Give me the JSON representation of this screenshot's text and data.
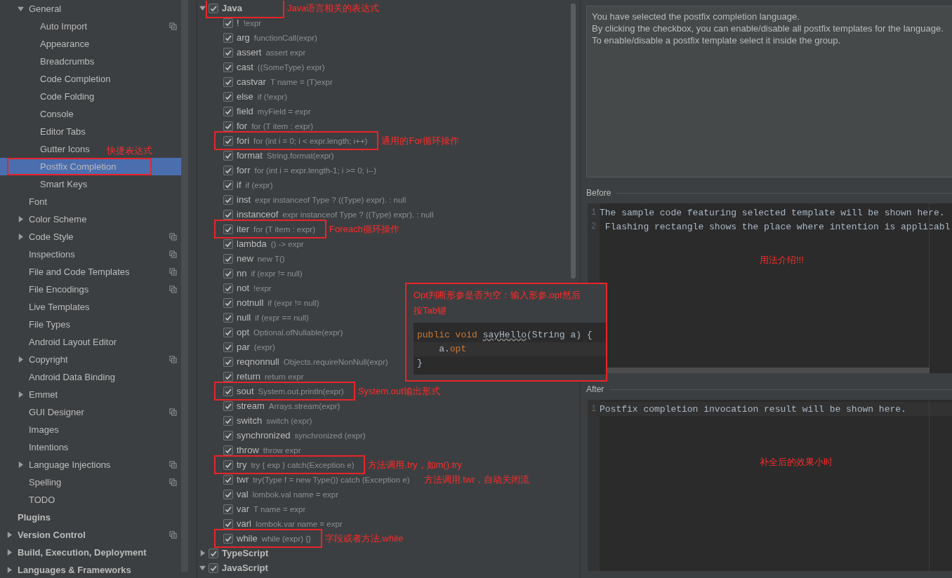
{
  "sidebar": {
    "editor_pages": [
      {
        "label": "General",
        "expanded": true,
        "selected": false,
        "children": [
          {
            "label": "Auto Import",
            "shared": true,
            "selected": false
          },
          {
            "label": "Appearance",
            "selected": false
          },
          {
            "label": "Breadcrumbs",
            "selected": false
          },
          {
            "label": "Code Completion",
            "selected": false
          },
          {
            "label": "Code Folding",
            "selected": false
          },
          {
            "label": "Console",
            "selected": false
          },
          {
            "label": "Editor Tabs",
            "selected": false
          },
          {
            "label": "Gutter Icons",
            "selected": false
          },
          {
            "label": "Postfix Completion",
            "selected": true,
            "highlighted": true,
            "note": "快捷表达式"
          },
          {
            "label": "Smart Keys",
            "selected": false
          }
        ]
      },
      {
        "label": "Font",
        "selected": false
      },
      {
        "label": "Color Scheme",
        "expanded": false,
        "selected": false
      },
      {
        "label": "Code Style",
        "expanded": false,
        "shared": true,
        "selected": false
      },
      {
        "label": "Inspections",
        "shared": true,
        "selected": false
      },
      {
        "label": "File and Code Templates",
        "shared": true,
        "selected": false
      },
      {
        "label": "File Encodings",
        "shared": true,
        "selected": false
      },
      {
        "label": "Live Templates",
        "selected": false
      },
      {
        "label": "File Types",
        "selected": false
      },
      {
        "label": "Android Layout Editor",
        "selected": false
      },
      {
        "label": "Copyright",
        "expanded": false,
        "shared": true,
        "selected": false
      },
      {
        "label": "Android Data Binding",
        "selected": false
      },
      {
        "label": "Emmet",
        "expanded": false,
        "selected": false
      },
      {
        "label": "GUI Designer",
        "shared": true,
        "selected": false
      },
      {
        "label": "Images",
        "selected": false
      },
      {
        "label": "Intentions",
        "selected": false
      },
      {
        "label": "Language Injections",
        "expanded": false,
        "shared": true,
        "selected": false
      },
      {
        "label": "Spelling",
        "shared": true,
        "selected": false
      },
      {
        "label": "TODO",
        "selected": false
      }
    ],
    "top_pages": [
      {
        "label": "Plugins",
        "selected": false
      },
      {
        "label": "Version Control",
        "expanded": false,
        "shared": true,
        "selected": false
      },
      {
        "label": "Build, Execution, Deployment",
        "expanded": false,
        "selected": false
      },
      {
        "label": "Languages & Frameworks",
        "expanded": false,
        "selected": false
      }
    ]
  },
  "templates": {
    "groups": [
      {
        "name": "Java",
        "checked": true,
        "expanded": true,
        "highlighted": true,
        "note": "Java语言相关的表达式",
        "templates": [
          {
            "key": "!",
            "example": "!expr",
            "checked": true,
            "highlighted": false
          },
          {
            "key": "arg",
            "example": "functionCall(expr)",
            "checked": true,
            "highlighted": false
          },
          {
            "key": "assert",
            "example": "assert expr",
            "checked": true,
            "highlighted": false
          },
          {
            "key": "cast",
            "example": "((SomeType) expr)",
            "checked": true,
            "highlighted": false
          },
          {
            "key": "castvar",
            "example": "T name = (T)expr",
            "checked": true,
            "highlighted": false
          },
          {
            "key": "else",
            "example": "if (!expr)",
            "checked": true,
            "highlighted": false
          },
          {
            "key": "field",
            "example": "myField = expr",
            "checked": true,
            "highlighted": false
          },
          {
            "key": "for",
            "example": "for (T item : expr)",
            "checked": true,
            "highlighted": false
          },
          {
            "key": "fori",
            "example": "for (int i = 0; i < expr.length; i++)",
            "checked": true,
            "highlighted": true,
            "note": "通用的For循环操作"
          },
          {
            "key": "format",
            "example": "String.format(expr)",
            "checked": true,
            "highlighted": false
          },
          {
            "key": "forr",
            "example": "for (int i = expr.length-1; i >= 0; i--)",
            "checked": true,
            "highlighted": false
          },
          {
            "key": "if",
            "example": "if (expr)",
            "checked": true,
            "highlighted": false
          },
          {
            "key": "inst",
            "example": "expr instanceof Type ? ((Type) expr). : null",
            "checked": true,
            "highlighted": false
          },
          {
            "key": "instanceof",
            "example": "expr instanceof Type ? ((Type) expr). : null",
            "checked": true,
            "highlighted": false
          },
          {
            "key": "iter",
            "example": "for (T item : expr)",
            "checked": true,
            "highlighted": true,
            "note": "Foreach循环操作"
          },
          {
            "key": "lambda",
            "example": "() -> expr",
            "checked": true,
            "highlighted": false
          },
          {
            "key": "new",
            "example": "new T()",
            "checked": true,
            "highlighted": false
          },
          {
            "key": "nn",
            "example": "if (expr != null)",
            "checked": true,
            "highlighted": false
          },
          {
            "key": "not",
            "example": "!expr",
            "checked": true,
            "highlighted": false
          },
          {
            "key": "notnull",
            "example": "if (expr != null)",
            "checked": true,
            "highlighted": false
          },
          {
            "key": "null",
            "example": "if (expr == null)",
            "checked": true,
            "highlighted": false
          },
          {
            "key": "opt",
            "example": "Optional.ofNullable(expr)",
            "checked": true,
            "highlighted": false
          },
          {
            "key": "par",
            "example": "(expr)",
            "checked": true,
            "highlighted": false
          },
          {
            "key": "reqnonnull",
            "example": "Objects.requireNonNull(expr)",
            "checked": true,
            "highlighted": false
          },
          {
            "key": "return",
            "example": "return expr",
            "checked": true,
            "highlighted": false
          },
          {
            "key": "sout",
            "example": "System.out.println(expr)",
            "checked": true,
            "highlighted": true,
            "note": "System.out输出形式"
          },
          {
            "key": "stream",
            "example": "Arrays.stream(expr)",
            "checked": true,
            "highlighted": false
          },
          {
            "key": "switch",
            "example": "switch (expr)",
            "checked": true,
            "highlighted": false
          },
          {
            "key": "synchronized",
            "example": "synchronized (expr)",
            "checked": true,
            "highlighted": false
          },
          {
            "key": "throw",
            "example": "throw expr",
            "checked": true,
            "highlighted": false
          },
          {
            "key": "try",
            "example": "try { exp } catch(Exception e)",
            "checked": true,
            "highlighted": true,
            "note": "方法调用.try，如m().try"
          },
          {
            "key": "twr",
            "example": "try(Type f = new Type()) catch (Exception e)",
            "checked": true,
            "highlighted": false,
            "note": "方法调用.twr，自动关闭流"
          },
          {
            "key": "val",
            "example": "lombok.val name = expr",
            "checked": true,
            "highlighted": false
          },
          {
            "key": "var",
            "example": "T name = expr",
            "checked": true,
            "highlighted": false
          },
          {
            "key": "varl",
            "example": "lombok.var name = expr",
            "checked": true,
            "highlighted": false
          },
          {
            "key": "while",
            "example": "while (expr) {}",
            "checked": true,
            "highlighted": true,
            "note": "字段或者方法.while"
          }
        ]
      },
      {
        "name": "TypeScript",
        "checked": true,
        "expanded": false,
        "highlighted": false
      },
      {
        "name": "JavaScript",
        "checked": true,
        "expanded": true,
        "highlighted": false
      }
    ]
  },
  "description": {
    "lines": [
      "You have selected the postfix completion language.",
      "By clicking the checkbox, you can enable/disable all postfix templates for the language.",
      "To enable/disable a postfix template select it inside the group."
    ]
  },
  "before": {
    "label": "Before",
    "lines": [
      {
        "number": "1",
        "text": "The sample code featuring selected template will be shown here."
      },
      {
        "number": "2",
        "text": " Flashing rectangle shows the place where intention is applicabl"
      }
    ],
    "note": "用法介绍!!!"
  },
  "after": {
    "label": "After",
    "lines": [
      {
        "number": "1",
        "text": "Postfix completion invocation result will be shown here."
      }
    ],
    "note": "补全后的效果小时"
  },
  "callout": {
    "text": "Opt判断形参是否为空：输入形参.opt然后按Tab键",
    "code": [
      [
        {
          "text": "public void ",
          "kind": "keyword"
        },
        {
          "text": "sayHello",
          "kind": "warning"
        },
        {
          "text": "(String a) {",
          "kind": "plain"
        }
      ],
      [
        {
          "text": "    a.",
          "kind": "plain"
        },
        {
          "text": "opt",
          "kind": "keyword"
        }
      ],
      [
        {
          "text": "}",
          "kind": "plain"
        }
      ]
    ]
  }
}
